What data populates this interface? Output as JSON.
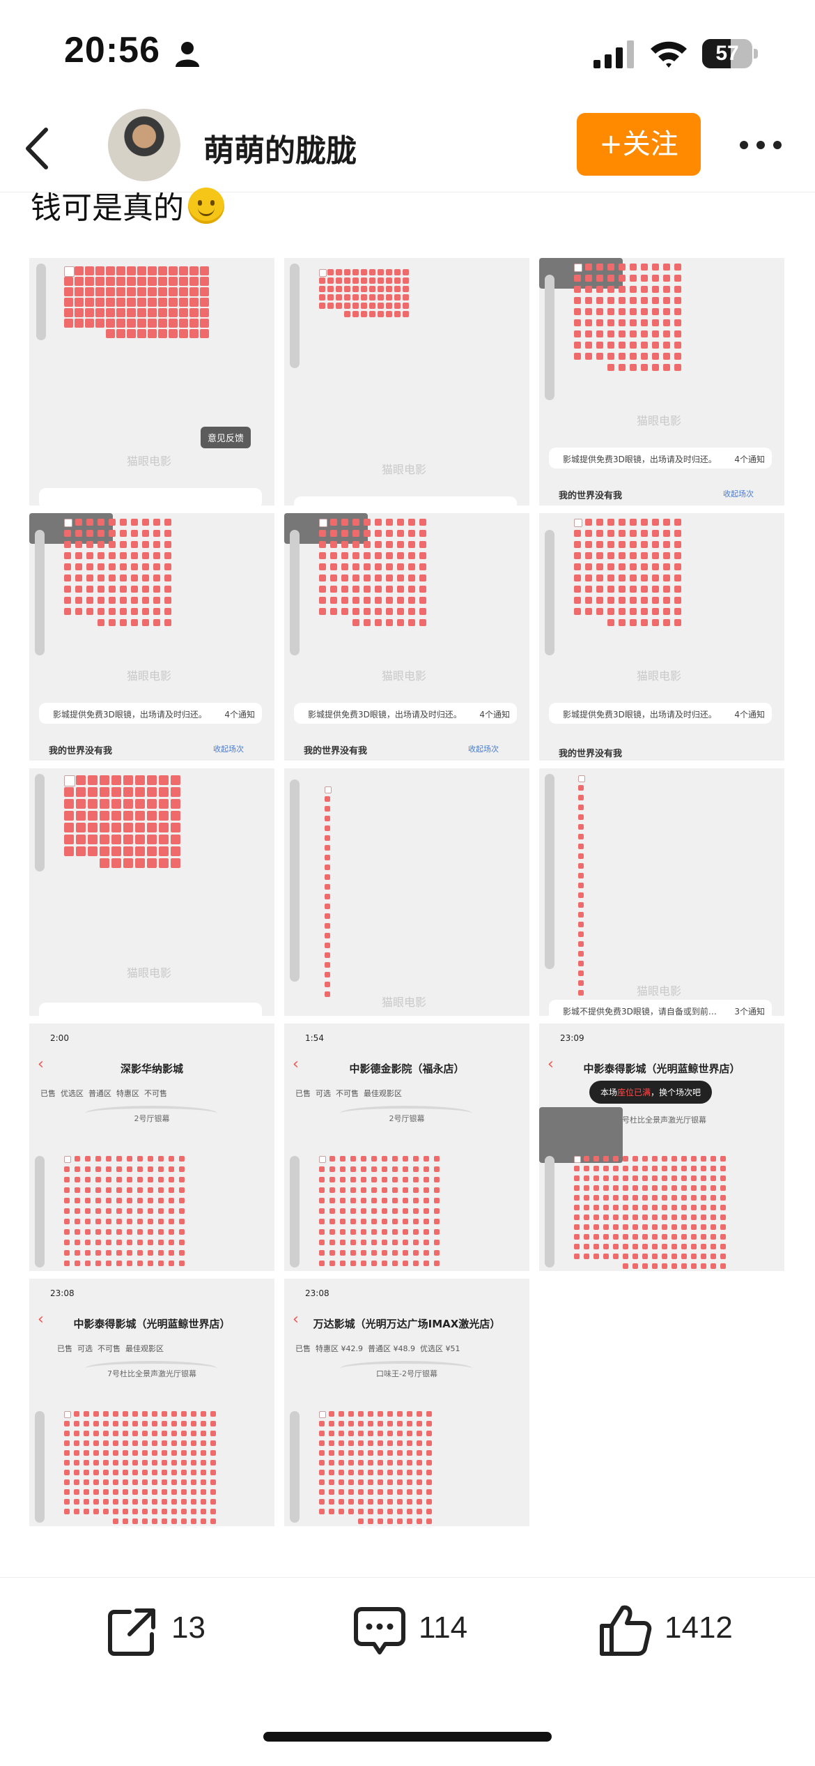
{
  "status_bar": {
    "time": "20:56",
    "battery": "57",
    "battery_level": 0.57
  },
  "header": {
    "username": "萌萌的胧胧",
    "follow_label": "+关注"
  },
  "post": {
    "text": "钱可是真的"
  },
  "images": {
    "watermark": "猫眼电影",
    "feedback": "意见反馈",
    "notice_free3d": "影城提供免费3D眼镜，出场请及时归还。",
    "notice_no3d": "影城不提供免费3D眼镜，请自备或到前…",
    "notice_count4": "4个通知",
    "notice_count3": "3个通知",
    "hall_title": "我的世界没有我",
    "hall_title_partial": "我的世界没有我",
    "collapse": "收起场次",
    "cinema_1": "深影华纳影城",
    "cinema_2": "中影德金影院（福永店）",
    "cinema_3": "中影泰得影城（光明蓝鲸世界店）",
    "cinema_4": "中影泰得影城（光明蓝鲸世界店）",
    "cinema_5": "万达影城（光明万达广场IMAX激光店）",
    "time_1": "2:00",
    "time_2": "1:54",
    "time_3": "23:09",
    "time_4": "23:08",
    "time_5": "23:08",
    "legend_1": [
      "已售",
      "优选区",
      "普通区",
      "特惠区",
      "不可售"
    ],
    "legend_2": [
      "已售",
      "可选",
      "不可售",
      "最佳观影区"
    ],
    "legend_3": [
      "已售",
      "可选",
      "不可售",
      "最佳观影区"
    ],
    "legend_4": [
      "已售",
      "可选",
      "不可售",
      "最佳观影区"
    ],
    "legend_5": [
      "已售",
      "特惠区 ¥42.9",
      "普通区 ¥48.9",
      "优选区 ¥51"
    ],
    "screen_1": "2号厅银幕",
    "screen_2": "2号厅银幕",
    "screen_3": "7号杜比全景声激光厅银幕",
    "screen_4": "7号杜比全景声激光厅银幕",
    "screen_5": "口味王-2号厅银幕",
    "toast": {
      "prefix": "本场",
      "highlight": "座位已满",
      "suffix": "，换个场次吧"
    }
  },
  "actions": {
    "share_count": "13",
    "comment_count": "114",
    "like_count": "1412"
  },
  "colors": {
    "seat_sold": "#ef6b6b",
    "seat_free": "#ffffff",
    "seat_yellow": "#fff5c9",
    "follow": "#ff8a00"
  }
}
